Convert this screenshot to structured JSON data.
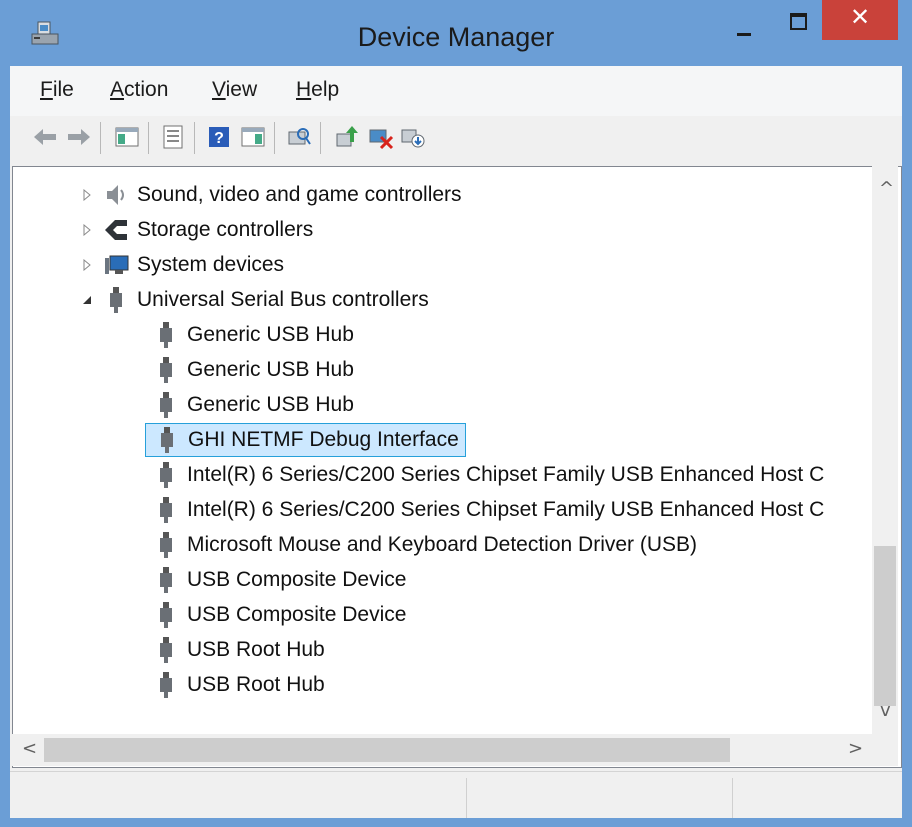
{
  "window": {
    "title": "Device Manager",
    "close_glyph": "✕",
    "colors": {
      "frame": "#6b9ed6",
      "close_button": "#c9423a",
      "selection_bg": "#cce8ff",
      "selection_border": "#26a0da"
    }
  },
  "menu": {
    "items": [
      {
        "label": "File",
        "underline": "F",
        "rest": "ile"
      },
      {
        "label": "Action",
        "underline": "A",
        "rest": "ction"
      },
      {
        "label": "View",
        "underline": "V",
        "rest": "iew"
      },
      {
        "label": "Help",
        "underline": "H",
        "rest": "elp"
      }
    ]
  },
  "toolbar": {
    "buttons": [
      "back-icon",
      "forward-icon",
      "show-hide-console-tree-icon",
      "properties-icon",
      "help-icon",
      "show-action-pane-icon",
      "scan-hardware-changes-icon",
      "update-driver-icon",
      "uninstall-device-icon",
      "disable-device-icon"
    ]
  },
  "tree": {
    "categories": [
      {
        "label": "Sound, video and game controllers",
        "icon": "speaker-icon",
        "expanded": false
      },
      {
        "label": "Storage controllers",
        "icon": "storage-controller-icon",
        "expanded": false
      },
      {
        "label": "System devices",
        "icon": "system-devices-icon",
        "expanded": false
      },
      {
        "label": "Universal Serial Bus controllers",
        "icon": "usb-plug-icon",
        "expanded": true
      }
    ],
    "usb_devices": [
      {
        "label": "Generic USB Hub"
      },
      {
        "label": "Generic USB Hub"
      },
      {
        "label": "Generic USB Hub"
      },
      {
        "label": "GHI NETMF Debug Interface",
        "selected": true
      },
      {
        "label": "Intel(R) 6 Series/C200 Series Chipset Family USB Enhanced Host C"
      },
      {
        "label": "Intel(R) 6 Series/C200 Series Chipset Family USB Enhanced Host C"
      },
      {
        "label": "Microsoft Mouse and Keyboard Detection Driver (USB)"
      },
      {
        "label": "USB Composite Device"
      },
      {
        "label": "USB Composite Device"
      },
      {
        "label": "USB Root Hub"
      },
      {
        "label": "USB Root Hub"
      }
    ]
  },
  "scrollbars": {
    "up_arrow": "^",
    "down_arrow": "v",
    "left_arrow": "<",
    "right_arrow": ">"
  }
}
